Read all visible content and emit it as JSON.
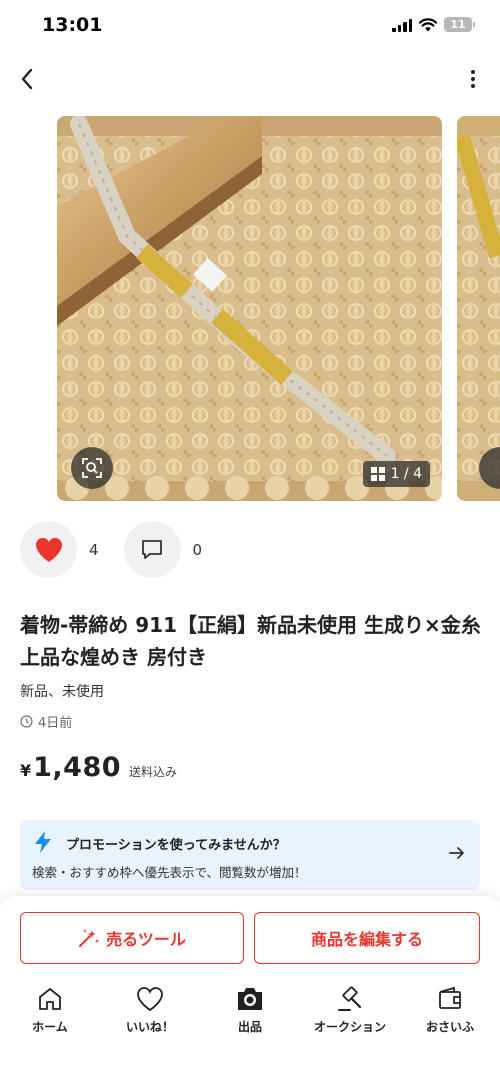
{
  "status_bar": {
    "time": "13:01",
    "battery": "11"
  },
  "nav": {
    "back_icon": "chevron-left-icon",
    "more_icon": "more-vertical-icon"
  },
  "gallery": {
    "counter": "1 / 4",
    "lens_icon": "image-search-icon",
    "grid_icon": "grid-icon"
  },
  "engagement": {
    "like_count": "4",
    "comment_count": "0",
    "like_color": "#ea352d"
  },
  "item": {
    "title": "着物-帯締め 911【正絹】新品未使用 生成り×金糸 上品な煌めき 房付き",
    "condition": "新品、未使用",
    "posted": "4日前",
    "currency": "¥",
    "price": "1,480",
    "shipping": "送料込み"
  },
  "promo": {
    "title": "プロモーションを使ってみませんか？",
    "subtitle": "検索・おすすめ枠へ優先表示で、閲覧数が増加！",
    "accent": "#1a8ee8",
    "background": "#e8f3fd"
  },
  "buttons": {
    "sell_tool": "売るツール",
    "edit_item": "商品を編集する",
    "accent": "#ea352d"
  },
  "tabbar": {
    "home": "ホーム",
    "likes": "いいね！",
    "sell": "出品",
    "auction": "オークション",
    "wallet": "おさいふ"
  }
}
